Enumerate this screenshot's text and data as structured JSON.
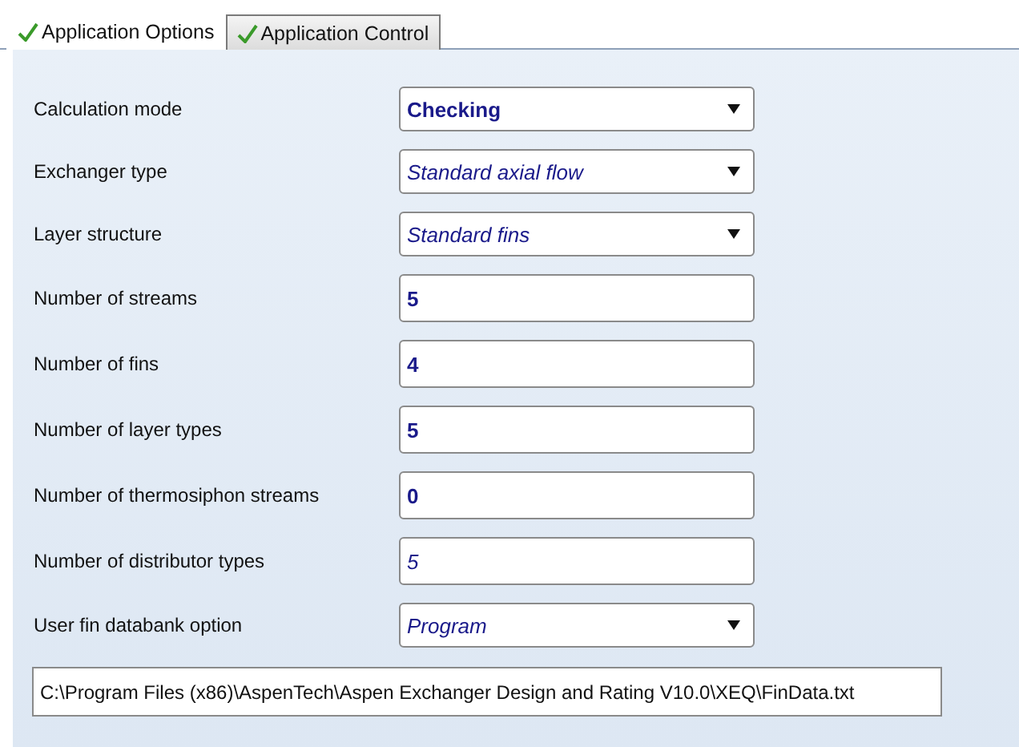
{
  "tabs": [
    {
      "label": "Application Options",
      "selected": true,
      "checked": true
    },
    {
      "label": "Application Control",
      "selected": false,
      "checked": true
    }
  ],
  "fields": [
    {
      "label": "Calculation mode",
      "kind": "dropdown",
      "value": "Checking",
      "default": false
    },
    {
      "label": "Exchanger type",
      "kind": "dropdown",
      "value": "Standard axial flow",
      "default": true
    },
    {
      "label": "Layer structure",
      "kind": "dropdown",
      "value": "Standard fins",
      "default": true
    },
    {
      "label": "Number of streams",
      "kind": "text",
      "value": "5",
      "default": false
    },
    {
      "label": "Number of fins",
      "kind": "text",
      "value": "4",
      "default": false
    },
    {
      "label": "Number of layer types",
      "kind": "text",
      "value": "5",
      "default": false
    },
    {
      "label": "Number of thermosiphon streams",
      "kind": "text",
      "value": "0",
      "default": false
    },
    {
      "label": "Number of distributor types",
      "kind": "text",
      "value": "5",
      "default": true
    },
    {
      "label": "User fin databank option",
      "kind": "dropdown",
      "value": "Program",
      "default": true
    }
  ],
  "file_path": "C:\\Program Files (x86)\\AspenTech\\Aspen Exchanger Design and Rating V10.0\\XEQ\\FinData.txt"
}
